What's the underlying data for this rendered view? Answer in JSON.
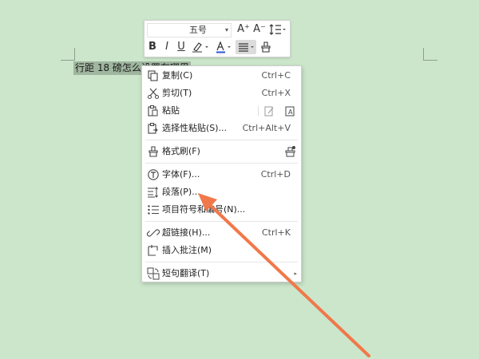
{
  "document": {
    "selected_text": "行距 18 磅怎么设置在哪里"
  },
  "mini_toolbar": {
    "font_name": "",
    "font_size": "五号",
    "grow_font_icon": "A⁺",
    "shrink_font_icon": "A⁻",
    "bold": "B",
    "italic": "I",
    "underline": "U",
    "font_color_letter": "A",
    "accent_color": "#2b55d9"
  },
  "context_menu": {
    "items": [
      {
        "label": "复制(C)",
        "shortcut": "Ctrl+C",
        "icon": "copy-icon"
      },
      {
        "label": "剪切(T)",
        "shortcut": "Ctrl+X",
        "icon": "cut-icon"
      },
      {
        "label": "粘贴",
        "shortcut": "",
        "icon": "paste-icon"
      },
      {
        "label": "选择性粘贴(S)...",
        "shortcut": "Ctrl+Alt+V",
        "icon": "paste-special-icon"
      },
      {
        "label": "格式刷(F)",
        "shortcut": "",
        "icon": "format-painter-icon"
      },
      {
        "label": "字体(F)...",
        "shortcut": "Ctrl+D",
        "icon": "font-icon"
      },
      {
        "label": "段落(P)...",
        "shortcut": "",
        "icon": "paragraph-icon"
      },
      {
        "label": "项目符号和编号(N)...",
        "shortcut": "",
        "icon": "bullet-list-icon"
      },
      {
        "label": "超链接(H)...",
        "shortcut": "Ctrl+K",
        "icon": "hyperlink-icon"
      },
      {
        "label": "插入批注(M)",
        "shortcut": "",
        "icon": "comment-icon"
      },
      {
        "label": "短句翻译(T)",
        "shortcut": "",
        "icon": "translate-icon"
      }
    ]
  },
  "annotation": {
    "arrow_color": "#f0784a"
  }
}
